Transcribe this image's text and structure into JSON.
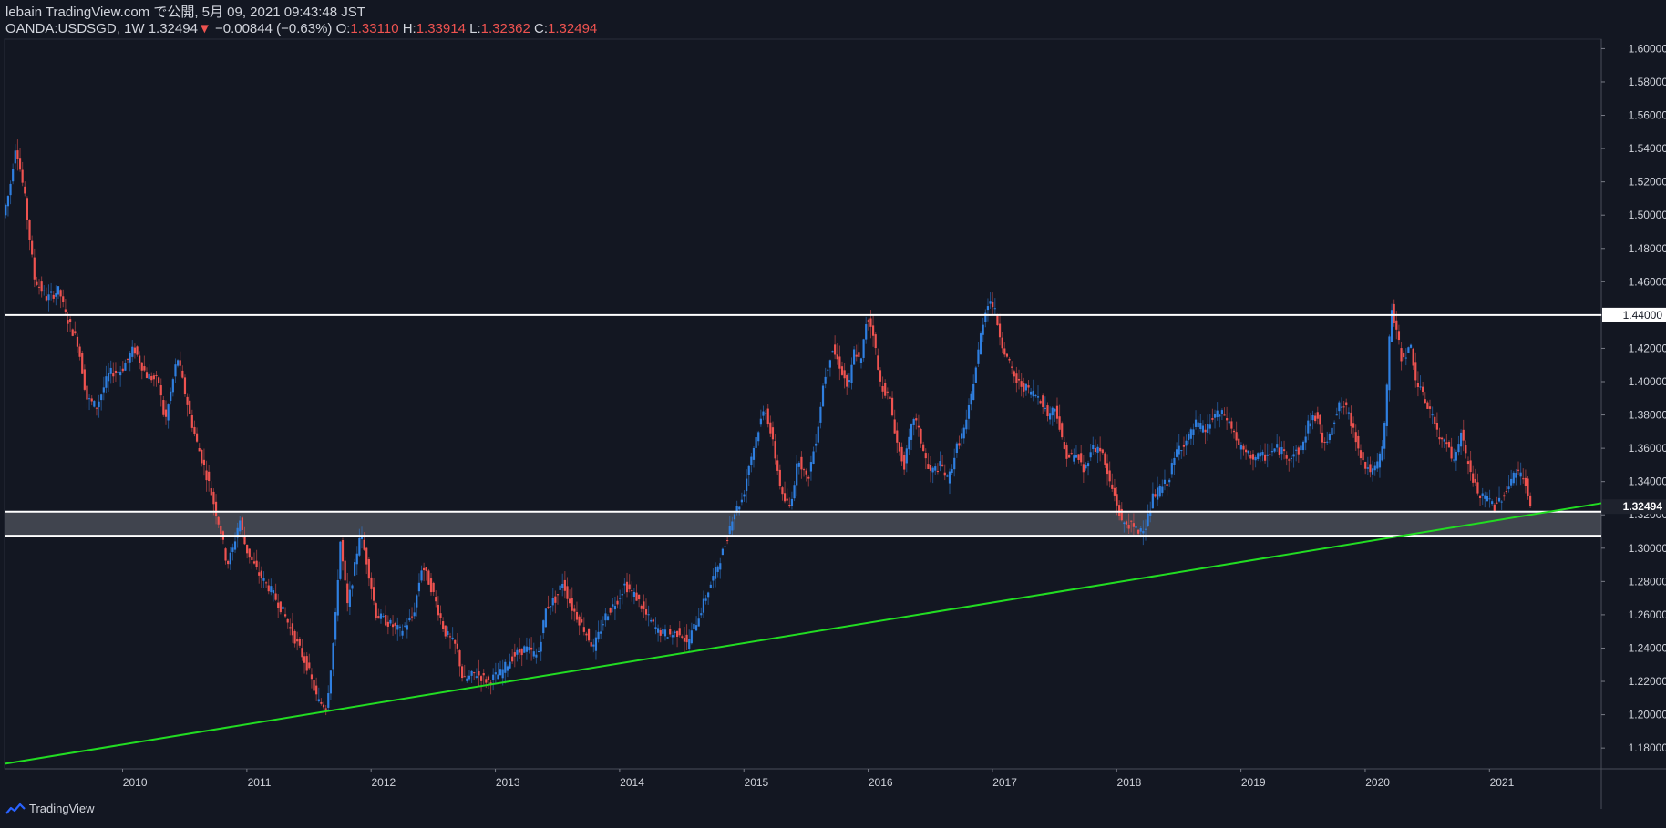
{
  "header": {
    "publish_line": "lebain TradingView.com で公開, 5月 09, 2021 09:43:48 JST",
    "symbol": "OANDA:USDSGD, 1W",
    "last": "1.32494",
    "change_arrow": "▼",
    "change": "−0.00844 (−0.63%)",
    "o_label": "O:",
    "o_value": "1.33110",
    "h_label": "H:",
    "h_value": "1.33914",
    "l_label": "L:",
    "l_value": "1.32362",
    "c_label": "C:",
    "c_value": "1.32494"
  },
  "footer": {
    "brand": "TradingView",
    "icon": "tradingview-logo-icon"
  },
  "colors": {
    "background": "#131722",
    "up": "#2f7fe0",
    "down": "#ef5350",
    "support": "#ffffff",
    "zone": "#9598a1",
    "trendline": "#22dd22",
    "grid": "#363a45"
  },
  "chart_data": {
    "type": "candlestick",
    "title": "",
    "symbol": "OANDA:USDSGD",
    "interval": "1W",
    "x_range": [
      2009.05,
      2021.9
    ],
    "y_range": [
      1.1675,
      1.6057
    ],
    "grid": false,
    "y_ticks": [
      "1.18000",
      "1.20000",
      "1.22000",
      "1.24000",
      "1.26000",
      "1.28000",
      "1.30000",
      "1.32000",
      "1.34000",
      "1.36000",
      "1.38000",
      "1.40000",
      "1.42000",
      "1.44000",
      "1.46000",
      "1.48000",
      "1.50000",
      "1.52000",
      "1.54000",
      "1.56000",
      "1.58000",
      "1.60000"
    ],
    "x_ticks": [
      "2010",
      "2011",
      "2012",
      "2013",
      "2014",
      "2015",
      "2016",
      "2017",
      "2018",
      "2019",
      "2020",
      "2021"
    ],
    "last_price": "1.32494",
    "horizontal_lines": [
      1.44,
      1.3219,
      1.3075
    ],
    "label_1440": "1.44000",
    "zone": {
      "from": 1.3075,
      "to": 1.3219
    },
    "trendline": {
      "x1": 2009.05,
      "y1": 1.1705,
      "x2": 2021.9,
      "y2": 1.327
    },
    "price_path": [
      [
        2009.05,
        1.5
      ],
      [
        2009.1,
        1.515
      ],
      [
        2009.15,
        1.543
      ],
      [
        2009.22,
        1.512
      ],
      [
        2009.3,
        1.462
      ],
      [
        2009.4,
        1.45
      ],
      [
        2009.5,
        1.455
      ],
      [
        2009.55,
        1.44
      ],
      [
        2009.65,
        1.423
      ],
      [
        2009.72,
        1.39
      ],
      [
        2009.8,
        1.385
      ],
      [
        2009.9,
        1.405
      ],
      [
        2010.0,
        1.407
      ],
      [
        2010.1,
        1.42
      ],
      [
        2010.2,
        1.404
      ],
      [
        2010.3,
        1.4
      ],
      [
        2010.35,
        1.375
      ],
      [
        2010.45,
        1.415
      ],
      [
        2010.55,
        1.38
      ],
      [
        2010.6,
        1.365
      ],
      [
        2010.7,
        1.34
      ],
      [
        2010.75,
        1.325
      ],
      [
        2010.8,
        1.31
      ],
      [
        2010.85,
        1.29
      ],
      [
        2010.9,
        1.3
      ],
      [
        2010.95,
        1.318
      ],
      [
        2011.0,
        1.3
      ],
      [
        2011.1,
        1.285
      ],
      [
        2011.2,
        1.275
      ],
      [
        2011.3,
        1.262
      ],
      [
        2011.4,
        1.245
      ],
      [
        2011.5,
        1.228
      ],
      [
        2011.58,
        1.208
      ],
      [
        2011.65,
        1.205
      ],
      [
        2011.68,
        1.225
      ],
      [
        2011.72,
        1.255
      ],
      [
        2011.76,
        1.305
      ],
      [
        2011.82,
        1.265
      ],
      [
        2011.88,
        1.29
      ],
      [
        2011.92,
        1.31
      ],
      [
        2011.98,
        1.29
      ],
      [
        2012.05,
        1.26
      ],
      [
        2012.15,
        1.255
      ],
      [
        2012.25,
        1.25
      ],
      [
        2012.35,
        1.26
      ],
      [
        2012.42,
        1.29
      ],
      [
        2012.5,
        1.275
      ],
      [
        2012.6,
        1.25
      ],
      [
        2012.7,
        1.24
      ],
      [
        2012.75,
        1.22
      ],
      [
        2012.85,
        1.225
      ],
      [
        2012.95,
        1.22
      ],
      [
        2013.05,
        1.225
      ],
      [
        2013.15,
        1.235
      ],
      [
        2013.25,
        1.24
      ],
      [
        2013.35,
        1.235
      ],
      [
        2013.42,
        1.265
      ],
      [
        2013.5,
        1.27
      ],
      [
        2013.55,
        1.28
      ],
      [
        2013.62,
        1.265
      ],
      [
        2013.72,
        1.252
      ],
      [
        2013.8,
        1.24
      ],
      [
        2013.9,
        1.26
      ],
      [
        2014.0,
        1.27
      ],
      [
        2014.05,
        1.278
      ],
      [
        2014.15,
        1.27
      ],
      [
        2014.22,
        1.26
      ],
      [
        2014.32,
        1.25
      ],
      [
        2014.42,
        1.248
      ],
      [
        2014.5,
        1.25
      ],
      [
        2014.55,
        1.242
      ],
      [
        2014.65,
        1.26
      ],
      [
        2014.75,
        1.28
      ],
      [
        2014.85,
        1.3
      ],
      [
        2014.92,
        1.32
      ],
      [
        2015.0,
        1.33
      ],
      [
        2015.05,
        1.35
      ],
      [
        2015.12,
        1.37
      ],
      [
        2015.18,
        1.385
      ],
      [
        2015.25,
        1.36
      ],
      [
        2015.32,
        1.33
      ],
      [
        2015.38,
        1.325
      ],
      [
        2015.45,
        1.355
      ],
      [
        2015.52,
        1.34
      ],
      [
        2015.6,
        1.37
      ],
      [
        2015.65,
        1.4
      ],
      [
        2015.72,
        1.42
      ],
      [
        2015.78,
        1.41
      ],
      [
        2015.85,
        1.395
      ],
      [
        2015.9,
        1.42
      ],
      [
        2015.95,
        1.41
      ],
      [
        2016.0,
        1.44
      ],
      [
        2016.05,
        1.43
      ],
      [
        2016.1,
        1.4
      ],
      [
        2016.18,
        1.39
      ],
      [
        2016.25,
        1.36
      ],
      [
        2016.3,
        1.35
      ],
      [
        2016.38,
        1.38
      ],
      [
        2016.45,
        1.36
      ],
      [
        2016.5,
        1.345
      ],
      [
        2016.6,
        1.35
      ],
      [
        2016.65,
        1.34
      ],
      [
        2016.72,
        1.36
      ],
      [
        2016.8,
        1.375
      ],
      [
        2016.88,
        1.41
      ],
      [
        2016.93,
        1.435
      ],
      [
        2016.98,
        1.45
      ],
      [
        2017.02,
        1.445
      ],
      [
        2017.08,
        1.425
      ],
      [
        2017.12,
        1.415
      ],
      [
        2017.2,
        1.4
      ],
      [
        2017.3,
        1.395
      ],
      [
        2017.4,
        1.39
      ],
      [
        2017.45,
        1.38
      ],
      [
        2017.52,
        1.385
      ],
      [
        2017.58,
        1.36
      ],
      [
        2017.62,
        1.355
      ],
      [
        2017.7,
        1.355
      ],
      [
        2017.75,
        1.345
      ],
      [
        2017.8,
        1.36
      ],
      [
        2017.88,
        1.36
      ],
      [
        2017.95,
        1.34
      ],
      [
        2018.0,
        1.33
      ],
      [
        2018.05,
        1.315
      ],
      [
        2018.1,
        1.315
      ],
      [
        2018.18,
        1.31
      ],
      [
        2018.25,
        1.315
      ],
      [
        2018.3,
        1.33
      ],
      [
        2018.35,
        1.335
      ],
      [
        2018.42,
        1.34
      ],
      [
        2018.5,
        1.36
      ],
      [
        2018.58,
        1.365
      ],
      [
        2018.65,
        1.375
      ],
      [
        2018.72,
        1.37
      ],
      [
        2018.8,
        1.38
      ],
      [
        2018.88,
        1.38
      ],
      [
        2018.95,
        1.37
      ],
      [
        2019.0,
        1.36
      ],
      [
        2019.08,
        1.355
      ],
      [
        2019.2,
        1.355
      ],
      [
        2019.3,
        1.36
      ],
      [
        2019.4,
        1.355
      ],
      [
        2019.5,
        1.36
      ],
      [
        2019.55,
        1.375
      ],
      [
        2019.62,
        1.38
      ],
      [
        2019.68,
        1.36
      ],
      [
        2019.72,
        1.37
      ],
      [
        2019.8,
        1.385
      ],
      [
        2019.85,
        1.385
      ],
      [
        2019.92,
        1.37
      ],
      [
        2020.0,
        1.35
      ],
      [
        2020.08,
        1.345
      ],
      [
        2020.15,
        1.36
      ],
      [
        2020.18,
        1.39
      ],
      [
        2020.2,
        1.42
      ],
      [
        2020.22,
        1.445
      ],
      [
        2020.26,
        1.43
      ],
      [
        2020.3,
        1.415
      ],
      [
        2020.38,
        1.42
      ],
      [
        2020.42,
        1.4
      ],
      [
        2020.48,
        1.39
      ],
      [
        2020.55,
        1.38
      ],
      [
        2020.6,
        1.365
      ],
      [
        2020.68,
        1.365
      ],
      [
        2020.72,
        1.35
      ],
      [
        2020.78,
        1.37
      ],
      [
        2020.82,
        1.355
      ],
      [
        2020.88,
        1.34
      ],
      [
        2020.94,
        1.33
      ],
      [
        2021.0,
        1.33
      ],
      [
        2021.05,
        1.325
      ],
      [
        2021.1,
        1.33
      ],
      [
        2021.15,
        1.335
      ],
      [
        2021.2,
        1.345
      ],
      [
        2021.25,
        1.345
      ],
      [
        2021.3,
        1.34
      ],
      [
        2021.33,
        1.3249
      ]
    ]
  }
}
